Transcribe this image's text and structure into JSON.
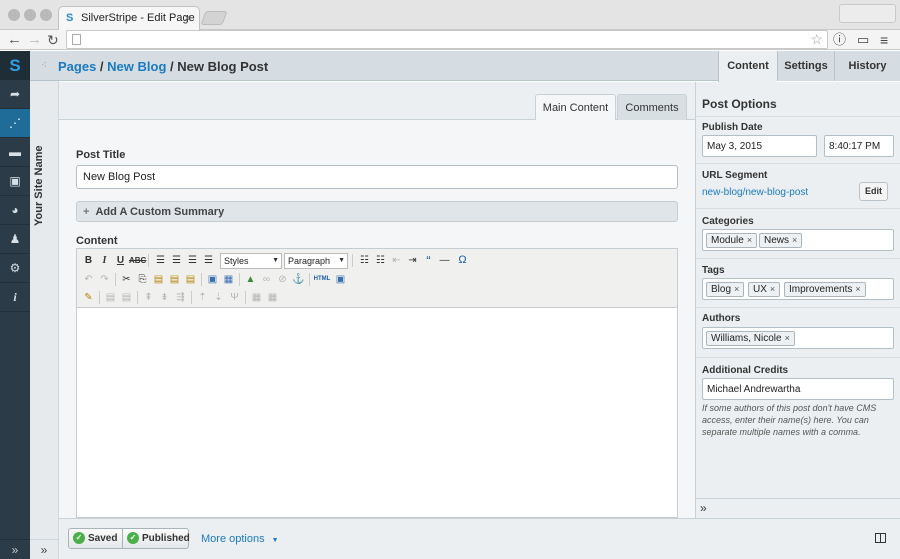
{
  "browser": {
    "tab_title": "SilverStripe - Edit Page",
    "tab_close": "×",
    "favicon": "S"
  },
  "cms_menu": {
    "logo": "S",
    "items": [
      {
        "icon": "logout-icon",
        "glyph": "➦",
        "active": false
      },
      {
        "icon": "site-tree-icon",
        "glyph": "⋰",
        "active": true
      },
      {
        "icon": "comments-icon",
        "glyph": "▬",
        "active": false
      },
      {
        "icon": "files-icon",
        "glyph": "▣",
        "active": false
      },
      {
        "icon": "reports-icon",
        "glyph": "◕",
        "active": false
      },
      {
        "icon": "security-icon",
        "glyph": "♟",
        "active": false
      },
      {
        "icon": "settings-icon",
        "glyph": "⚙",
        "active": false
      },
      {
        "icon": "help-icon",
        "glyph": "i",
        "active": false
      }
    ],
    "collapse": "»"
  },
  "site_panel": {
    "name": "Your Site Name",
    "collapse": "»"
  },
  "header": {
    "breadcrumb": [
      {
        "label": "Pages",
        "link": true
      },
      {
        "label": "New Blog",
        "link": true
      },
      {
        "label": "New Blog Post",
        "link": false
      }
    ],
    "separator": " / ",
    "tabs": [
      {
        "label": "Content",
        "active": true
      },
      {
        "label": "Settings",
        "active": false
      },
      {
        "label": "History",
        "active": false
      }
    ]
  },
  "main": {
    "tabs": [
      {
        "label": "Main Content",
        "active": true
      },
      {
        "label": "Comments",
        "active": false
      }
    ],
    "post_title_label": "Post Title",
    "post_title_value": "New Blog Post",
    "summary_toggle": "Add A Custom Summary",
    "summary_plus": "+",
    "content_label": "Content",
    "editor": {
      "styles_select": "Styles",
      "format_select": "Paragraph"
    }
  },
  "sidebar": {
    "title": "Post Options",
    "publish_date_label": "Publish Date",
    "publish_date": "May 3, 2015",
    "publish_time": "8:40:17 PM",
    "url_segment_label": "URL Segment",
    "url_segment": "new-blog/new-blog-post",
    "edit_button": "Edit",
    "categories_label": "Categories",
    "categories": [
      "Module",
      "News"
    ],
    "tags_label": "Tags",
    "tags": [
      "Blog",
      "UX",
      "Improvements"
    ],
    "authors_label": "Authors",
    "authors": [
      "Williams, Nicole"
    ],
    "credits_label": "Additional Credits",
    "credits_value": "Michael Andrewartha",
    "credits_help": "If some authors of this post don't have CMS access, enter their name(s) here. You can separate multiple names with a comma.",
    "chip_remove": "×",
    "expand": "»"
  },
  "footer": {
    "saved": "Saved",
    "published": "Published",
    "more_options": "More options",
    "more_arrow": "▼"
  }
}
